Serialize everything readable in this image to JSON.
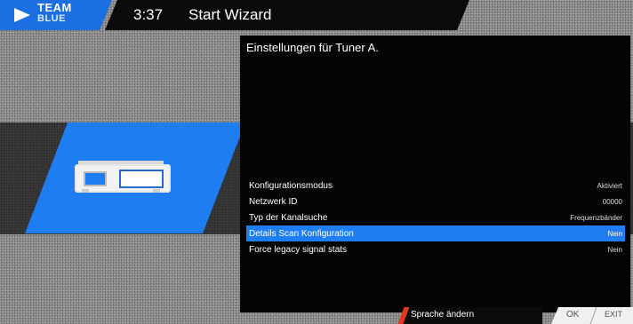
{
  "header": {
    "logo_line1": "TEAM",
    "logo_line2": "BLUE",
    "time": "3:37",
    "title": "Start Wizard"
  },
  "panel": {
    "title": "Einstellungen für Tuner A.",
    "items": [
      {
        "label": "Konfigurationsmodus",
        "value": "Aktiviert",
        "selected": false
      },
      {
        "label": "Netzwerk ID",
        "value": "00000",
        "selected": false
      },
      {
        "label": "Typ der Kanalsuche",
        "value": "Frequenzbänder",
        "selected": false
      },
      {
        "label": "Details Scan Konfiguration",
        "value": "Nein",
        "selected": true
      },
      {
        "label": "Force legacy signal stats",
        "value": "Nein",
        "selected": false
      }
    ]
  },
  "footer": {
    "help": "Sprache ändern",
    "ok": "OK",
    "exit": "EXIT"
  },
  "colors": {
    "accent": "#1e7df0",
    "help_accent": "#e0391e"
  },
  "icons": {
    "logo": "team-blue-logo",
    "device": "receiver-box-icon"
  }
}
